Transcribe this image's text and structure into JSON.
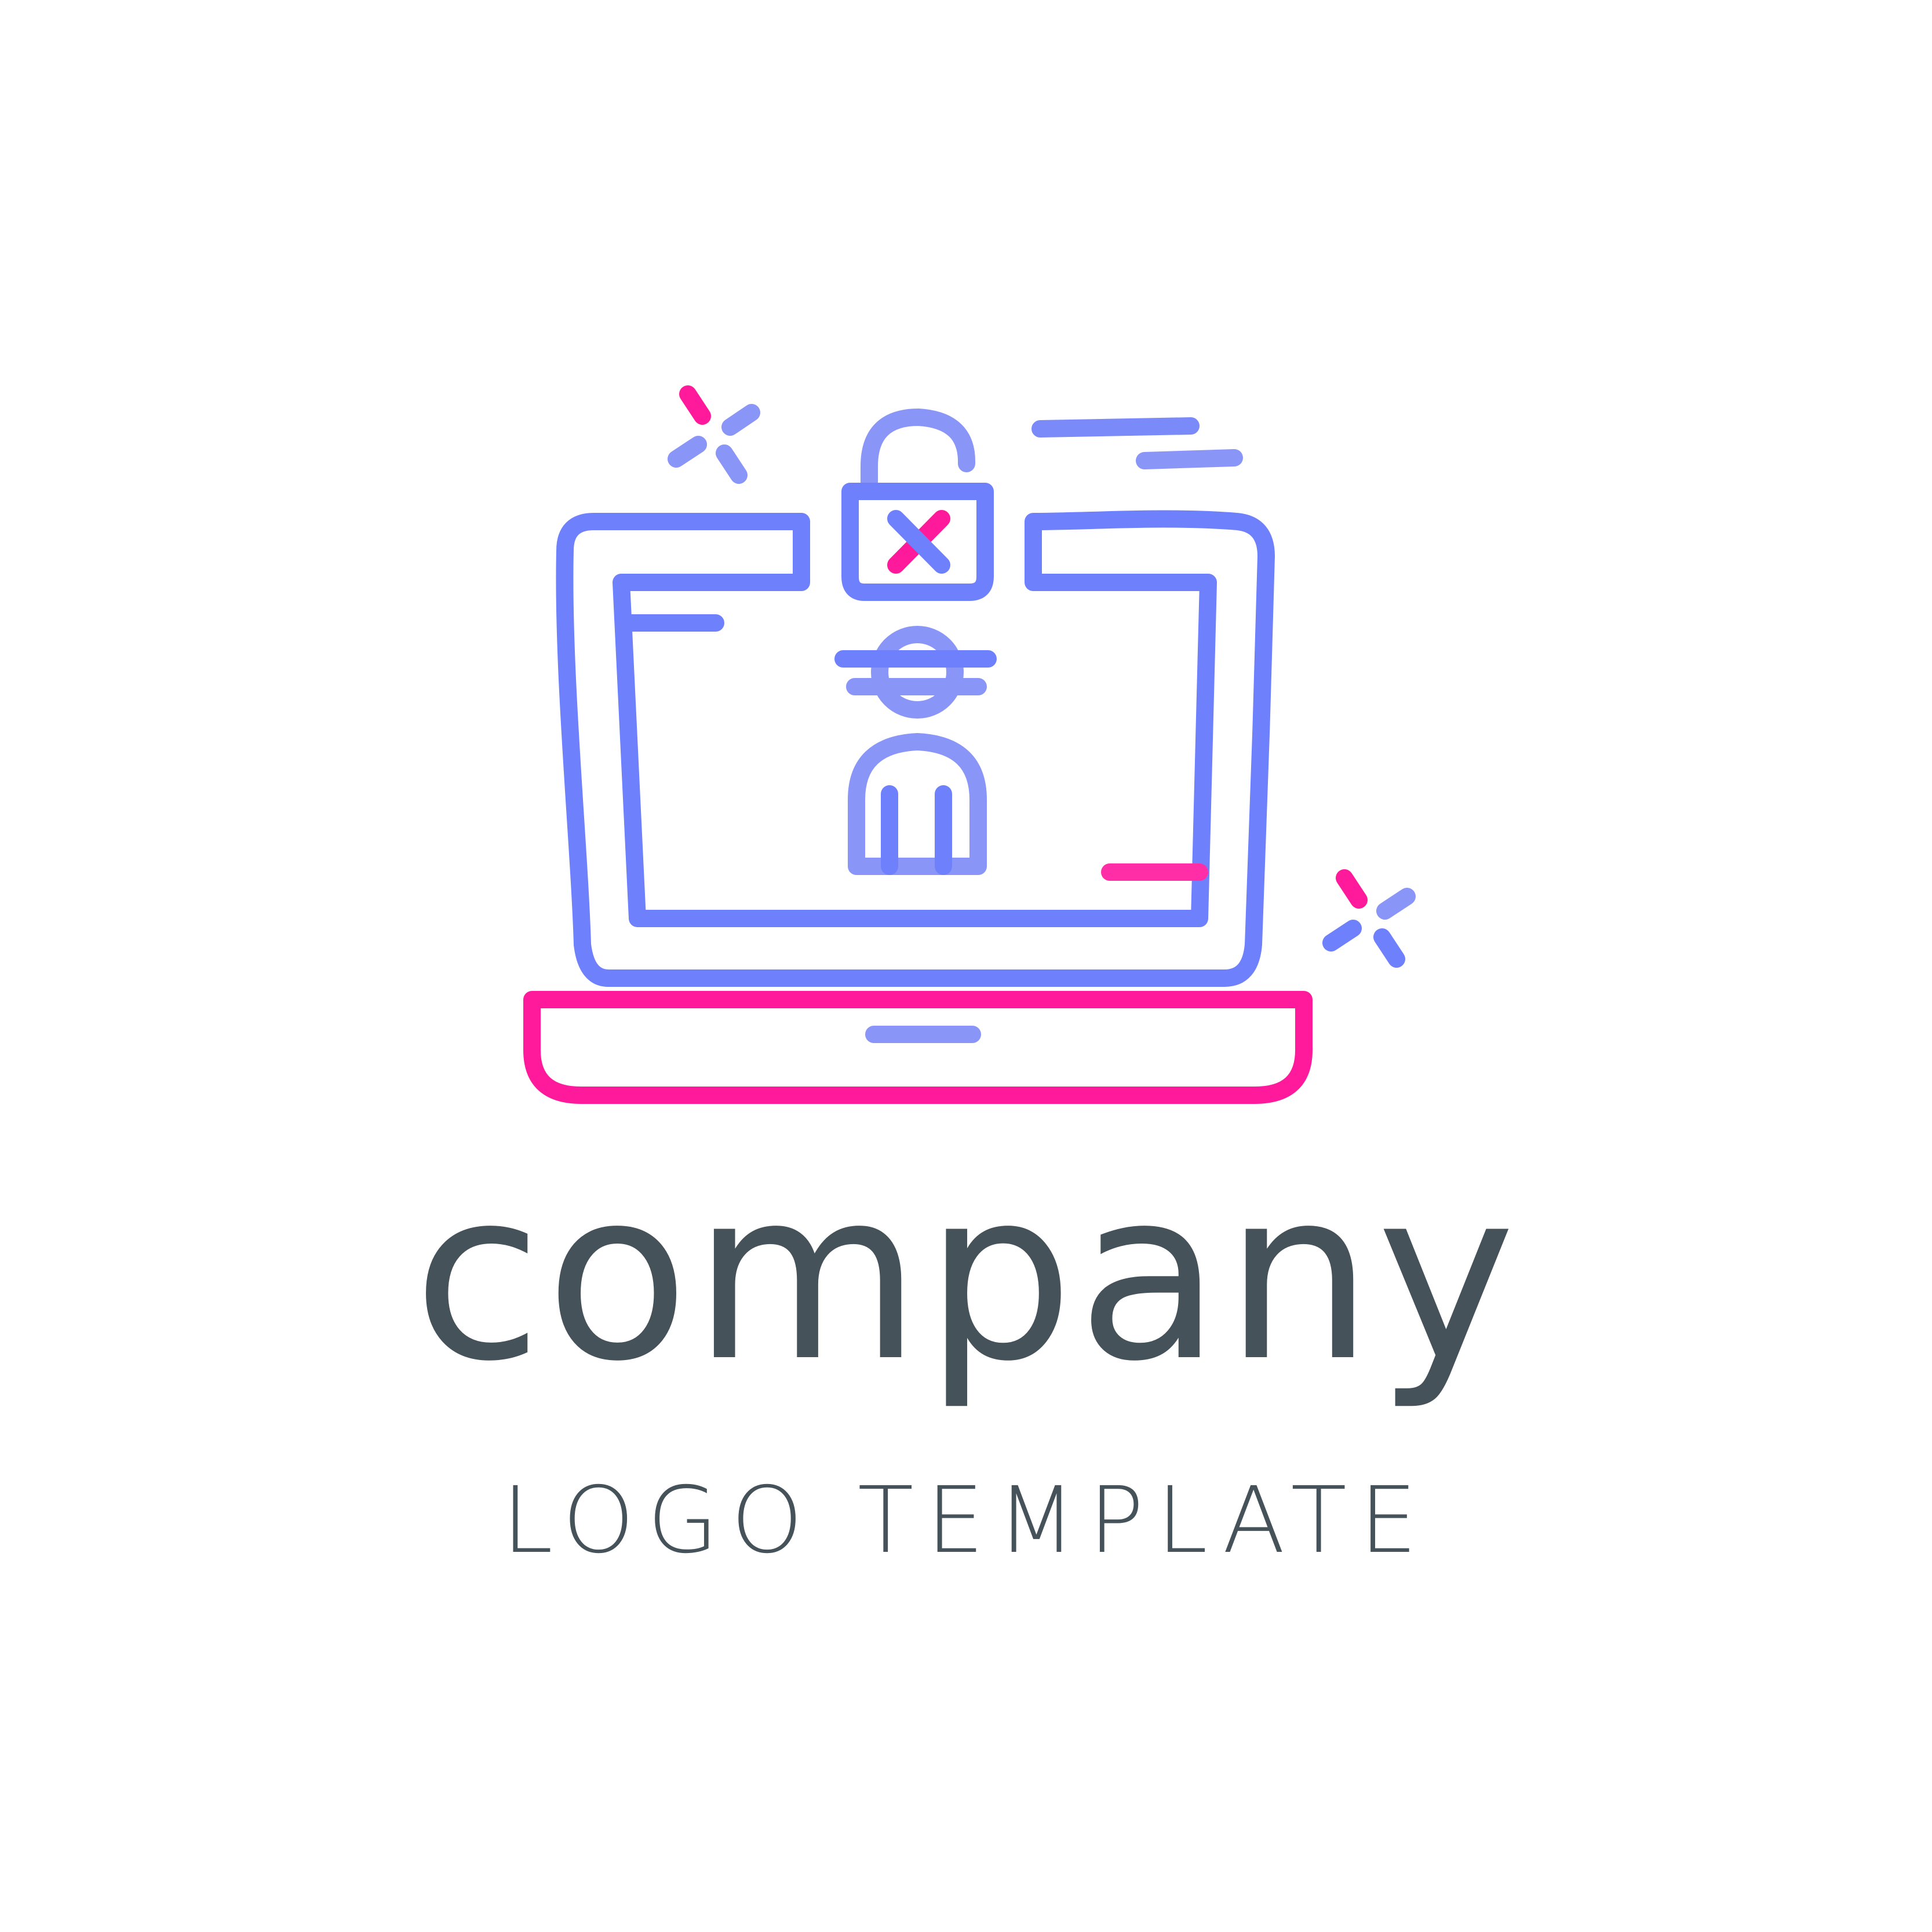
{
  "brand": {
    "name": "company",
    "tagline": "LOGO TEMPLATE"
  },
  "colors": {
    "text": "#45525a",
    "primary_stroke": "#6e80fb",
    "secondary_stroke": "#8a95f8",
    "accent_pink": "#ff1a9c",
    "background": "#ffffff"
  },
  "icon": {
    "name": "laptop-hacker-padlock-icon",
    "parts": [
      "laptop-screen",
      "laptop-base",
      "padlock",
      "hacker-figure",
      "sparkles",
      "speed-lines"
    ]
  }
}
